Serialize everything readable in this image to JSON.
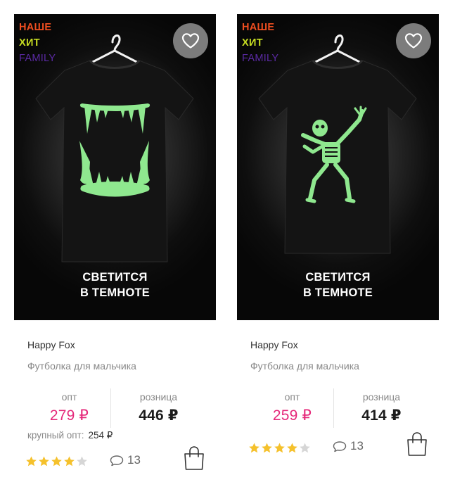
{
  "products": [
    {
      "badges": [
        "НАШЕ",
        "ХИТ",
        "FAMILY"
      ],
      "caption_line1": "СВЕТИТСЯ",
      "caption_line2": "В ТЕМНОТЕ",
      "print_icon": "glowing-fangs-icon",
      "brand": "Happy Fox",
      "title": "Футболка для мальчика",
      "opt_label": "опт",
      "opt_price": "279 ₽",
      "retail_label": "розница",
      "retail_price": "446 ₽",
      "bulk_label": "крупный опт:",
      "bulk_price": "254 ₽",
      "rating": 4,
      "rating_max": 5,
      "reviews": "13"
    },
    {
      "badges": [
        "НАШЕ",
        "ХИТ",
        "FAMILY"
      ],
      "caption_line1": "СВЕТИТСЯ",
      "caption_line2": "В ТЕМНОТЕ",
      "print_icon": "dabbing-skeleton-icon",
      "brand": "Happy Fox",
      "title": "Футболка для мальчика",
      "opt_label": "опт",
      "opt_price": "259 ₽",
      "retail_label": "розница",
      "retail_price": "414 ₽",
      "rating": 4,
      "rating_max": 5,
      "reviews": "13"
    }
  ],
  "icons": {
    "favorite": "heart-icon",
    "comments": "comment-icon",
    "cart": "shopping-bag-icon",
    "star": "star-icon"
  },
  "colors": {
    "badge_nashe": "#ef4e20",
    "badge_hit": "#c6dc22",
    "badge_family": "#5b2aa4",
    "opt_price": "#e5287a",
    "star_filled": "#f5c12c",
    "star_empty": "#d6d6d6",
    "glow": "#8fe88f"
  }
}
